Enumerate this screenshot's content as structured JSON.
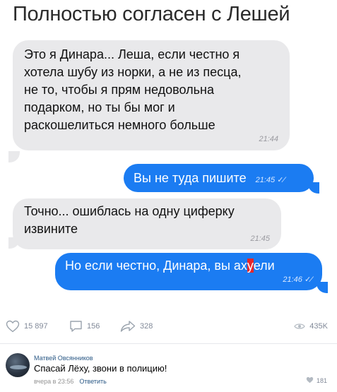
{
  "post": {
    "title": "Полностью согласен с Лешей"
  },
  "messages": [
    {
      "direction": "incoming",
      "lines": [
        "Это я Динара... Леша, если честно я",
        "хотела шубу из норки, а не из песца,",
        "не то, чтобы я прям недовольна",
        "подарком, но ты бы мог и",
        "раскошелиться немного больше"
      ],
      "time": "21:44"
    },
    {
      "direction": "outgoing",
      "text": "Вы не туда пишите",
      "time": "21:45 ✓⁄"
    },
    {
      "direction": "incoming",
      "lines": [
        "Точно... ошиблась на одну циферку",
        "извините"
      ],
      "time": "21:45"
    },
    {
      "direction": "outgoing",
      "text_before": "Но если честно, Динара, вы ах",
      "text_highlight": "у",
      "text_after": "ели",
      "time": "21:46 ✓⁄"
    }
  ],
  "actions": {
    "likes": "15 897",
    "comments": "156",
    "shares": "328",
    "views": "435K",
    "like_icon": "heart-icon",
    "comment_icon": "comment-icon",
    "share_icon": "share-icon",
    "views_icon": "eye-icon"
  },
  "comment": {
    "author": "Матвей Овсянников",
    "text": "Спасай Лёху, звони в полицию!",
    "time": "вчера в 23:56",
    "reply_label": "Ответить",
    "likes": "181"
  },
  "colors": {
    "incoming_bubble": "#e9e9eb",
    "outgoing_bubble": "#1b7cf2",
    "highlight": "#e8262a",
    "link": "#2a5885"
  }
}
